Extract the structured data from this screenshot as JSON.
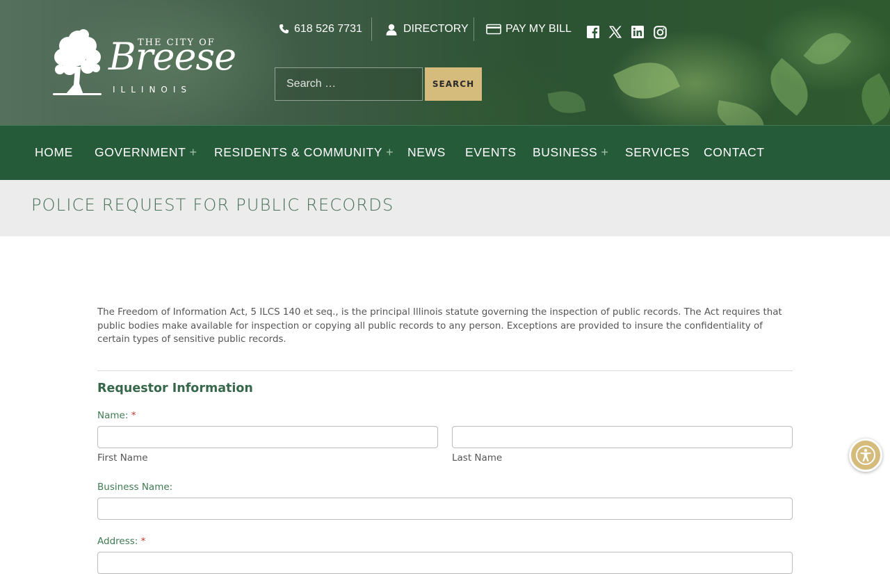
{
  "header": {
    "logo": {
      "small_text": "THE CITY OF",
      "name": "Breese",
      "state": "ILLINOIS"
    },
    "utility": {
      "phone": "618 526 7731",
      "directory": "DIRECTORY",
      "pay_bill": "PAY MY BILL"
    },
    "social": [
      "facebook-icon",
      "x-icon",
      "linkedin-icon",
      "instagram-icon"
    ],
    "search": {
      "placeholder": "Search …",
      "button": "SEARCH"
    }
  },
  "nav": {
    "items": [
      {
        "label": "HOME",
        "has_submenu": false
      },
      {
        "label": "GOVERNMENT",
        "has_submenu": true
      },
      {
        "label": "RESIDENTS & COMMUNITY",
        "has_submenu": true
      },
      {
        "label": "NEWS",
        "has_submenu": false
      },
      {
        "label": "EVENTS",
        "has_submenu": false
      },
      {
        "label": "BUSINESS",
        "has_submenu": true
      },
      {
        "label": "SERVICES",
        "has_submenu": false
      },
      {
        "label": "CONTACT",
        "has_submenu": false
      }
    ],
    "submenu_marker": "+"
  },
  "page": {
    "title": "POLICE REQUEST FOR PUBLIC RECORDS",
    "intro": "The Freedom of Information Act, 5 ILCS 140 et seq., is the principal Illinois statute governing the inspection of public records. The Act requires that public bodies make available for inspection or copying all public records to any person. Exceptions are provided to insure the confidentiality of certain types of sensitive public records."
  },
  "form": {
    "section_title": "Requestor Information",
    "required_marker": "*",
    "name_label": "Name:",
    "first_name_sublabel": "First Name",
    "last_name_sublabel": "Last Name",
    "first_name_value": "",
    "last_name_value": "",
    "business_label": "Business Name:",
    "business_value": "",
    "address_label": "Address:"
  },
  "colors": {
    "nav_bg": "#265b3a",
    "accent_gold": "#d5bc7d",
    "title_text": "#466f56",
    "label_green": "#3f7a52",
    "required_red": "#c0392b"
  }
}
